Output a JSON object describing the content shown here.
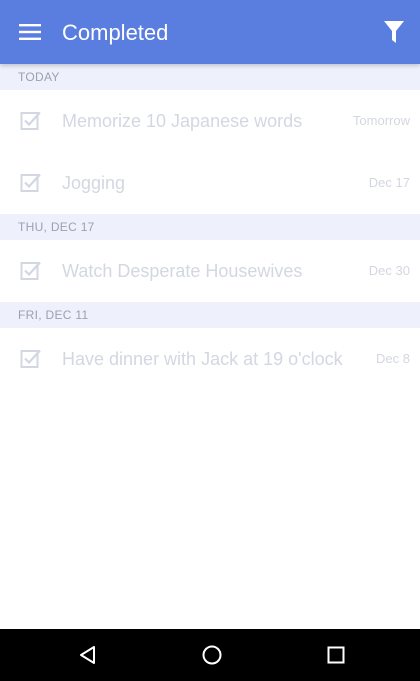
{
  "appbar": {
    "title": "Completed",
    "menu_icon": "hamburger-menu-icon",
    "filter_icon": "filter-icon",
    "color": "#5a7de0"
  },
  "sections": [
    {
      "header": "TODAY",
      "tasks": [
        {
          "title": "Memorize 10 Japanese words",
          "date": "Tomorrow",
          "completed": true
        },
        {
          "title": "Jogging",
          "date": "Dec 17",
          "completed": true
        }
      ]
    },
    {
      "header": "THU, DEC 17",
      "tasks": [
        {
          "title": "Watch Desperate Housewives",
          "date": "Dec 30",
          "completed": true
        }
      ]
    },
    {
      "header": "FRI, DEC 11",
      "tasks": [
        {
          "title": "Have dinner with Jack at 19 o'clock",
          "date": "Dec 8",
          "completed": true
        }
      ]
    }
  ],
  "navbar": {
    "back_icon": "back-triangle-icon",
    "home_icon": "home-circle-icon",
    "recents_icon": "recents-square-icon"
  },
  "colors": {
    "section_bg": "#eef0fb",
    "section_text": "#9aa1b3",
    "task_text": "#d3d7e1"
  }
}
